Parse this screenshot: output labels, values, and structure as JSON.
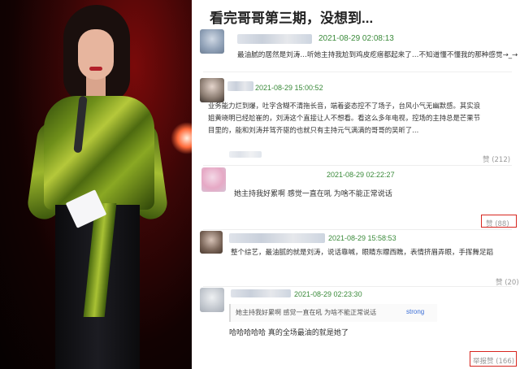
{
  "headline": "看完哥哥第三期，没想到...",
  "comments": [
    {
      "time": "2021-08-29 02:08:13",
      "text": "最油腻的居然是刘涛…听她主持我尬到鸡皮疙瘩都起来了…不知道懂不懂我的那种感觉→_→"
    },
    {
      "time": "2021-08-29 15:00:52",
      "text_lines": [
        "业务能力烂到爆，吐字含糊不清拖长音，端着姿态控不了场子，台风小气无幽默感。其实浪",
        "姐黄晓明已经尬崔的，刘涛这个直接让人不想看。看这么多年电视，控场的主持总是芒果节",
        "目里的，能和刘涛并驾齐驱的也就只有主持元气满满的哥哥的吴昕了..."
      ],
      "likes": "赞 (212)"
    },
    {
      "time": "2021-08-29 02:22:27",
      "text": "她主持我好累啊 感觉一直在吼 为啥不能正常说话",
      "likes": "赞 (88)"
    },
    {
      "time": "2021-08-29 15:58:53",
      "text": "整个综艺，最油腻的就是刘涛，说话靠喊，眼睛东瞟西瞧，表情挤眉弄眼，手挥舞足蹈",
      "likes": "赞 (20)"
    },
    {
      "time": "2021-08-29 02:23:30",
      "quote": "她主持我好累啊 感觉一直在吼 为啥不能正常说话",
      "quote_tag": "strong",
      "text": "哈哈哈哈哈  真的全场最油的就是她了",
      "report": "举报",
      "likes": "赞 (166)"
    }
  ],
  "colors": {
    "timestamp": "#3a8a3a",
    "highlight_box": "#d7261f",
    "quote_tag": "#3b6ed6"
  }
}
